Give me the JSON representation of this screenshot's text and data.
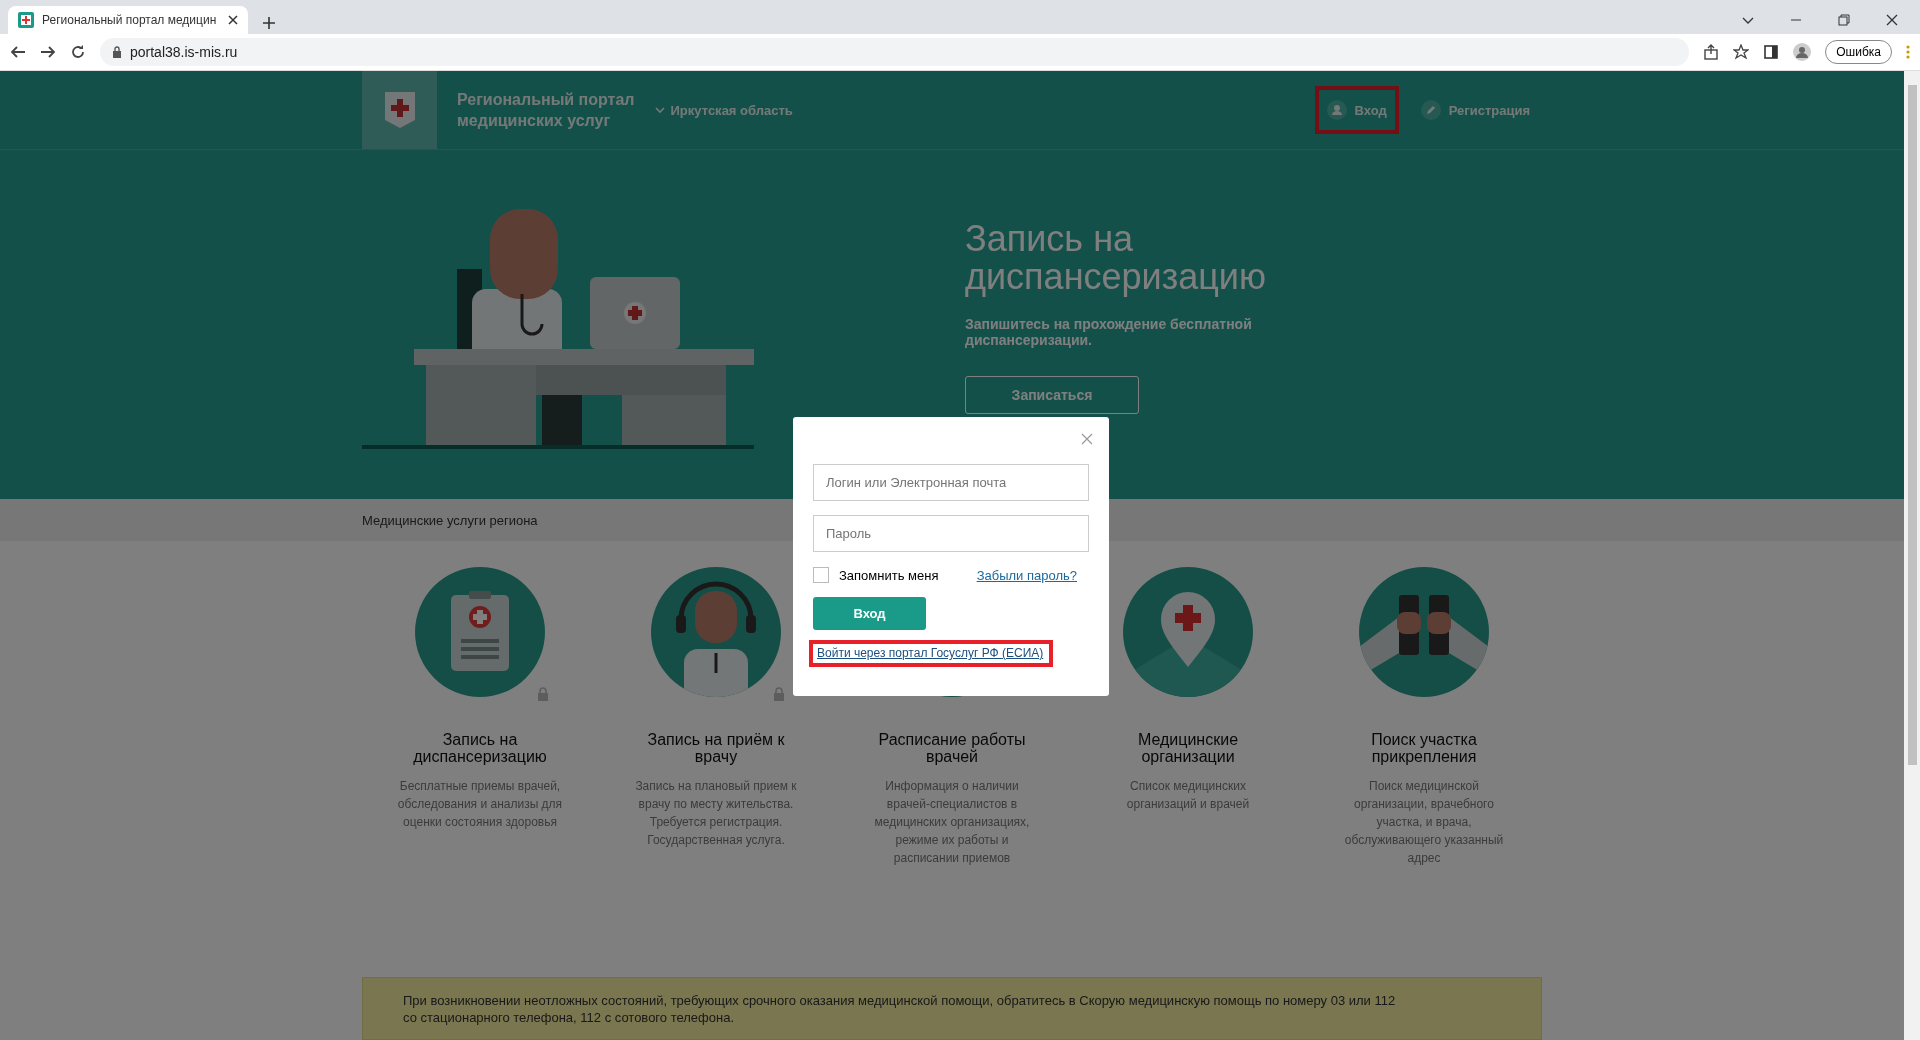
{
  "browser": {
    "tab_title": "Региональный портал медицин",
    "url": "portal38.is-mis.ru",
    "profile_button": "Ошибка"
  },
  "header": {
    "title_lines": [
      "Региональный портал",
      "медицинских услуг"
    ],
    "region": "Иркутская область",
    "nav": [
      {
        "kind": "user",
        "label": "Вход",
        "highlighted": true
      },
      {
        "kind": "edit",
        "label": "Регистрация",
        "highlighted": false
      }
    ]
  },
  "hero": {
    "title": "Запись на диспансеризацию",
    "subtitle": "Запишитесь на прохождение бесплатной диспансеризации.",
    "button": "Записаться"
  },
  "section_title": "Медицинские услуги региона",
  "services": [
    {
      "kind": "clipboard",
      "title": "Запись на диспансеризацию",
      "description": "Бесплатные приемы врачей, обследования и анализы для оценки состояния здоровья",
      "locked": true
    },
    {
      "kind": "operator",
      "title": "Запись на приём к врачу",
      "description": "Запись на плановый прием к врачу по месту жительства. Требуется регистрация. Государственная услуга.",
      "locked": true
    },
    {
      "kind": "plain",
      "title": "Расписание работы врачей",
      "description": "Информация о наличии врачей-специалистов в медицинских организациях, режиме их работы и расписании приемов",
      "locked": false
    },
    {
      "kind": "pin",
      "title": "Медицинские организации",
      "description": "Список медицинских организаций и врачей",
      "locked": false
    },
    {
      "kind": "binoculars",
      "title": "Поиск участка прикрепления",
      "description": "Поиск медицинской организации, врачебного участка, и врача, обслуживающего указанный адрес",
      "locked": false
    }
  ],
  "notice": [
    "При возникновении неотложных состояний, требующих срочного оказания медицинской помощи, обратитесь в Скорую медицинскую помощь по номеру 03 или 112",
    "со стационарного телефона, 112 с сотового телефона."
  ],
  "login_dialog": {
    "login_placeholder": "Логин или Электронная почта",
    "password_placeholder": "Пароль",
    "remember": {
      "label": "Запомнить меня",
      "checked": false
    },
    "forgot_link": "Забыли пароль?",
    "submit": "Вход",
    "esia_link": {
      "label": "Войти через портал Госуслуг РФ (ЕСИА)",
      "highlighted": true
    }
  }
}
